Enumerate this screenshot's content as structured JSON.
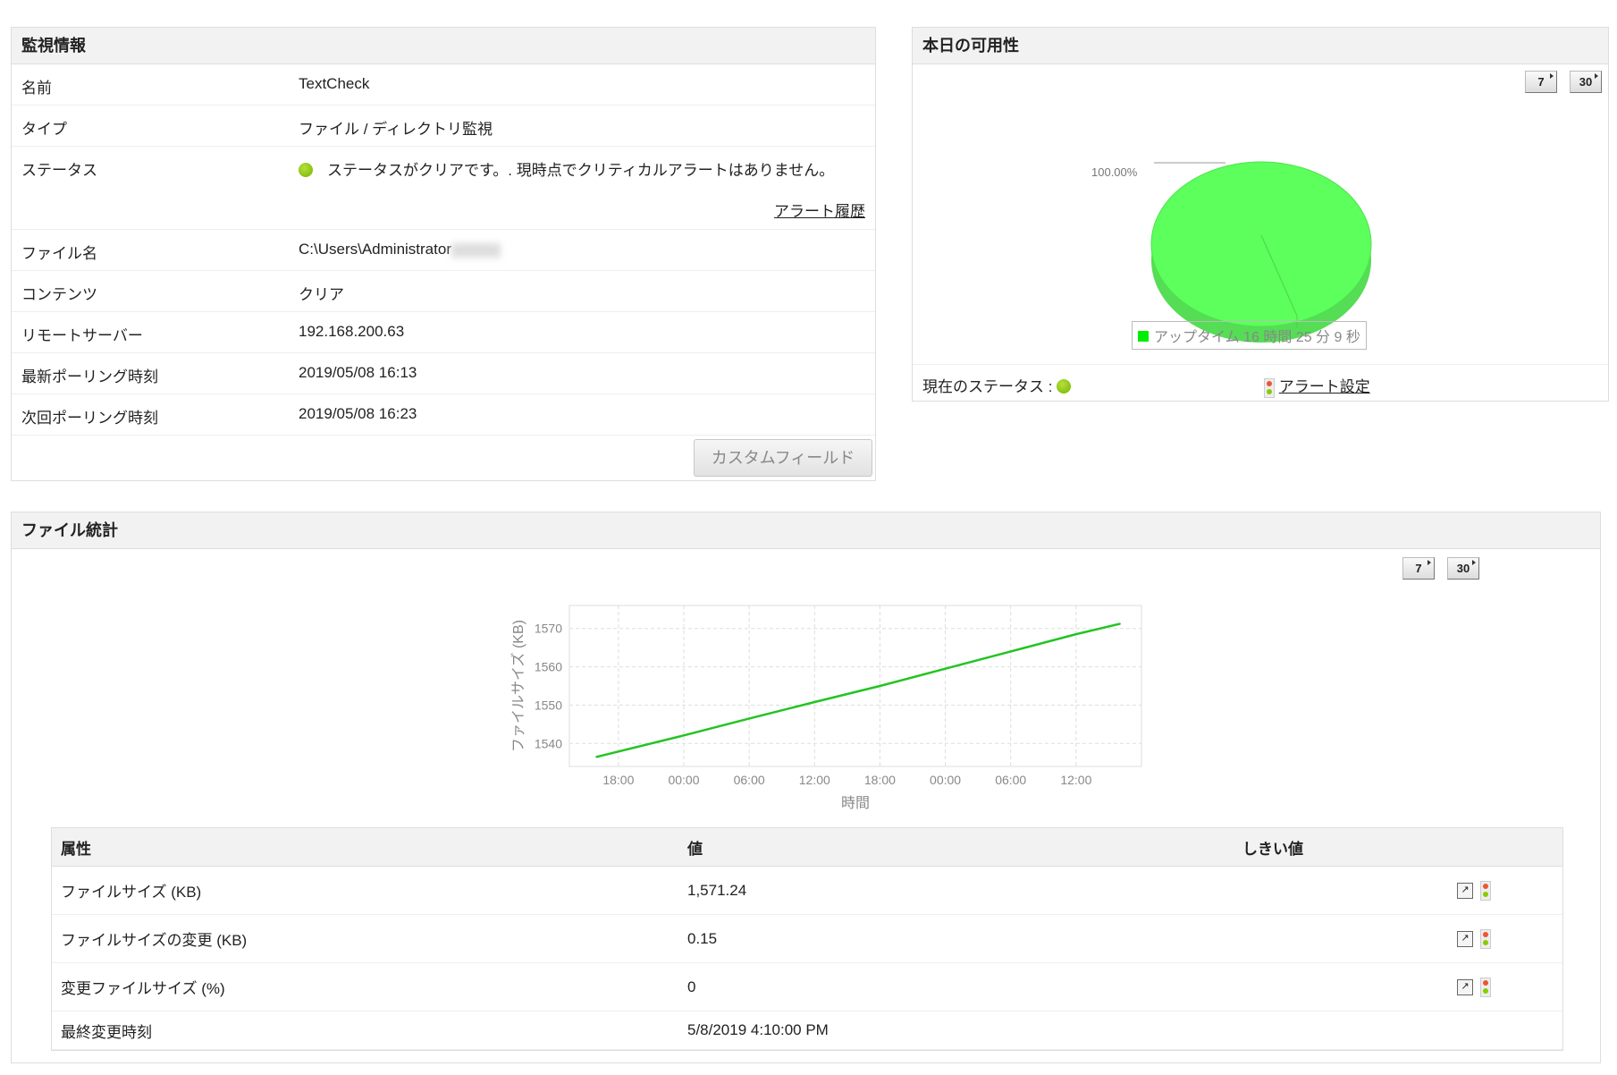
{
  "monitor": {
    "title": "監視情報",
    "rows": [
      {
        "label": "名前",
        "value": "TextCheck"
      },
      {
        "label": "タイプ",
        "value": "ファイル / ディレクトリ監視"
      },
      {
        "label": "ステータス",
        "value": "ステータスがクリアです。. 現時点でクリティカルアラートはありません。"
      },
      {
        "label": "ファイル名",
        "value": "C:\\Users\\Administrator"
      },
      {
        "label": "コンテンツ",
        "value": "クリア"
      },
      {
        "label": "リモートサーバー",
        "value": "192.168.200.63"
      },
      {
        "label": "最新ポーリング時刻",
        "value": "2019/05/08 16:13"
      },
      {
        "label": "次回ポーリング時刻",
        "value": "2019/05/08 16:23"
      }
    ],
    "alert_history": "アラート履歴",
    "custom_fields": "カスタムフィールド",
    "status_color": "#7fc000"
  },
  "availability": {
    "title": "本日の可用性",
    "btn7": "7",
    "btn30": "30",
    "pie_label": "100.00%",
    "uptime_percent": 100,
    "legend": "アップタイム 16 時間 25 分 9 秒",
    "current_status": "現在のステータス :",
    "alert_settings": "アラート設定",
    "color": "#5cff5c"
  },
  "stats": {
    "title": "ファイル統計",
    "btn7": "7",
    "btn30": "30",
    "columns": [
      "属性",
      "値",
      "しきい値"
    ],
    "rows": [
      {
        "attr": "ファイルサイズ (KB)",
        "value": "1,571.24",
        "threshold": true
      },
      {
        "attr": "ファイルサイズの変更 (KB)",
        "value": "0.15",
        "threshold": true
      },
      {
        "attr": "変更ファイルサイズ (%)",
        "value": "0",
        "threshold": true
      },
      {
        "attr": "最終変更時刻",
        "value": "5/8/2019 4:10:00 PM",
        "threshold": false
      }
    ]
  },
  "chart_data": {
    "type": "line",
    "xlabel": "時間",
    "ylabel": "ファイルサイズ (KB)",
    "ylim": [
      1534,
      1576
    ],
    "yticks": [
      1540,
      1550,
      1560,
      1570
    ],
    "xticks": [
      "18:00",
      "00:00",
      "06:00",
      "12:00",
      "18:00",
      "00:00",
      "06:00",
      "12:00"
    ],
    "xtick_hours": [
      2,
      8,
      14,
      20,
      26,
      32,
      38,
      44
    ],
    "xlim_hours": [
      -2.5,
      50
    ],
    "series": [
      {
        "name": "ファイルサイズ",
        "color": "#22c422",
        "x_hours": [
          0,
          8,
          14,
          20,
          26,
          32,
          38,
          44,
          48
        ],
        "values": [
          1536.5,
          1542.1,
          1546.5,
          1550.8,
          1555.0,
          1559.5,
          1564.0,
          1568.5,
          1571.2
        ]
      }
    ]
  }
}
